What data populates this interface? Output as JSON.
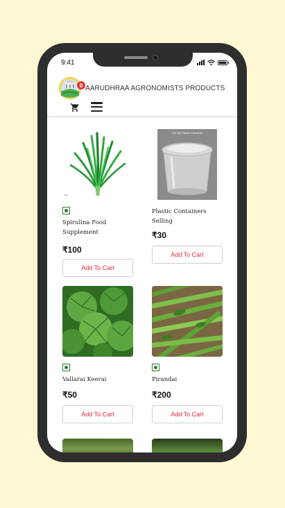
{
  "status_bar": {
    "time": "9:41"
  },
  "header": {
    "brand": "AARUDHRAA AGRONOMISTS PRODUCTS",
    "cart_count": "0"
  },
  "products": [
    {
      "name": "Spirulina Food Supplement",
      "price": "₹100",
      "button": "Add To Cart",
      "image": "spirulina-grass"
    },
    {
      "name": "Plastic Containers Selling",
      "price": "₹30",
      "button": "Add To Cart",
      "image": "plastic-container",
      "image_caption": "125 ML Plastic Container"
    },
    {
      "name": "Vallarai Keerai",
      "price": "₹50",
      "button": "Add To Cart",
      "image": "vallarai-leaves"
    },
    {
      "name": "Pirandai",
      "price": "₹200",
      "button": "Add To Cart",
      "image": "pirandai-stems"
    }
  ],
  "colors": {
    "accent": "#e0283e",
    "veg": "#2e7d32",
    "background": "#fdf8d3"
  }
}
